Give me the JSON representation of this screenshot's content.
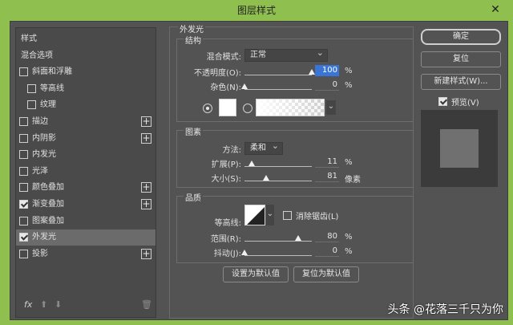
{
  "window": {
    "title": "图层样式",
    "close_glyph": "✕"
  },
  "left_panel": {
    "items": [
      {
        "label": "样式",
        "checkbox": false,
        "checked": false,
        "indent": 0,
        "plus": false,
        "selected": false
      },
      {
        "label": "混合选项",
        "checkbox": false,
        "checked": false,
        "indent": 0,
        "plus": false,
        "selected": false
      },
      {
        "label": "斜面和浮雕",
        "checkbox": true,
        "checked": false,
        "indent": 0,
        "plus": false,
        "selected": false
      },
      {
        "label": "等高线",
        "checkbox": true,
        "checked": false,
        "indent": 1,
        "plus": false,
        "selected": false
      },
      {
        "label": "纹理",
        "checkbox": true,
        "checked": false,
        "indent": 1,
        "plus": false,
        "selected": false
      },
      {
        "label": "描边",
        "checkbox": true,
        "checked": false,
        "indent": 0,
        "plus": true,
        "selected": false
      },
      {
        "label": "内阴影",
        "checkbox": true,
        "checked": false,
        "indent": 0,
        "plus": true,
        "selected": false
      },
      {
        "label": "内发光",
        "checkbox": true,
        "checked": false,
        "indent": 0,
        "plus": false,
        "selected": false
      },
      {
        "label": "光泽",
        "checkbox": true,
        "checked": false,
        "indent": 0,
        "plus": false,
        "selected": false
      },
      {
        "label": "颜色叠加",
        "checkbox": true,
        "checked": false,
        "indent": 0,
        "plus": true,
        "selected": false
      },
      {
        "label": "渐变叠加",
        "checkbox": true,
        "checked": true,
        "indent": 0,
        "plus": true,
        "selected": false
      },
      {
        "label": "图案叠加",
        "checkbox": true,
        "checked": false,
        "indent": 0,
        "plus": false,
        "selected": false
      },
      {
        "label": "外发光",
        "checkbox": true,
        "checked": true,
        "indent": 0,
        "plus": false,
        "selected": true
      },
      {
        "label": "投影",
        "checkbox": true,
        "checked": false,
        "indent": 0,
        "plus": true,
        "selected": false
      }
    ],
    "plus_glyph": "+",
    "footer": {
      "fx": "fx",
      "up": "⬆",
      "down": "⬇",
      "trash": "🗑"
    }
  },
  "outer_glow": {
    "section_title": "外发光",
    "structure": {
      "title": "结构",
      "blend_mode_label": "混合模式:",
      "blend_mode_value": "正常",
      "opacity_label": "不透明度(O):",
      "opacity_value": "100",
      "opacity_fraction": 1.0,
      "opacity_unit": "%",
      "noise_label": "杂色(N):",
      "noise_value": "0",
      "noise_fraction": 0.0,
      "noise_unit": "%"
    },
    "elements": {
      "title": "图素",
      "technique_label": "方法:",
      "technique_value": "柔和",
      "spread_label": "扩展(P):",
      "spread_value": "11",
      "spread_fraction": 0.11,
      "spread_unit": "%",
      "size_label": "大小(S):",
      "size_value": "81",
      "size_fraction": 0.32,
      "size_unit": "像素"
    },
    "quality": {
      "title": "品质",
      "contour_label": "等高线:",
      "antialias_label": "消除锯齿(L)",
      "antialias_checked": false,
      "range_label": "范围(R):",
      "range_value": "80",
      "range_fraction": 0.8,
      "range_unit": "%",
      "jitter_label": "抖动(J):",
      "jitter_value": "0",
      "jitter_fraction": 0.0,
      "jitter_unit": "%"
    },
    "make_default_label": "设置为默认值",
    "reset_default_label": "复位为默认值"
  },
  "actions": {
    "ok_label": "确定",
    "reset_label": "复位",
    "new_style_label": "新建样式(W)...",
    "preview_label": "预览(V)",
    "preview_checked": true
  },
  "watermark": "头条 @花落三千只为你",
  "colors": {
    "accent": "#3875d7",
    "dialog_bg": "#535353",
    "frame": "#8fbf4e"
  }
}
